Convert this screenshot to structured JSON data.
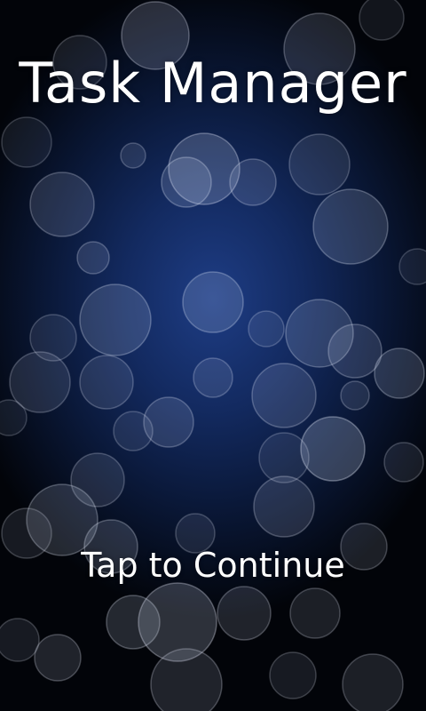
{
  "app": {
    "title": "Task Manager"
  },
  "splash": {
    "tap_prompt": "Tap to Continue",
    "background_style": "blue bokeh",
    "colors": {
      "background_center": "#1e3d85",
      "background_edge": "#020409",
      "text": "#ffffff"
    }
  }
}
